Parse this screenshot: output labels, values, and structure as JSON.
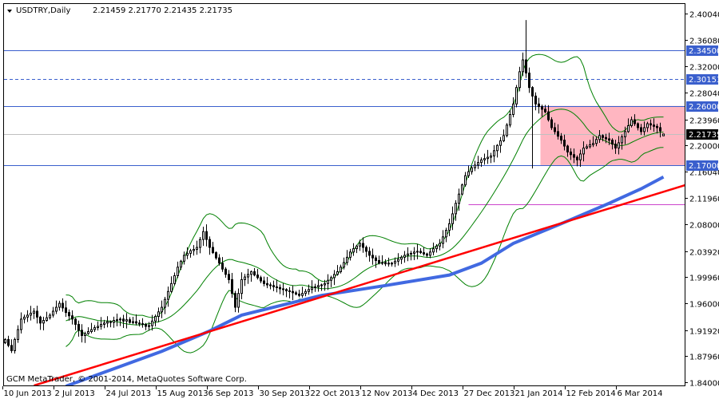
{
  "header": {
    "symbol_timeframe": "USDTRY,Daily",
    "ohlc": "2.21459 2.21770 2.21435 2.21735",
    "menu_icon": "triangle-down-icon"
  },
  "watermark": "GCM MetaTrader, © 2001-2014, MetaQuotes Software Corp.",
  "colors": {
    "bull_body": "#ffffff",
    "bear_body": "#000000",
    "bollinger": "#008000",
    "moving_average": "#4169e1",
    "trendline": "#ff0000",
    "levels": "#3a5fcd",
    "support_line": "#cc44cc",
    "range_box": "#ffb6c1",
    "bid_line": "#c0c0c0"
  },
  "chart_data": {
    "type": "candlestick",
    "symbol": "USDTRY",
    "timeframe": "Daily",
    "ylim": [
      1.84,
      2.4004
    ],
    "grid": false,
    "y_ticks": [
      "2.40040",
      "2.36080",
      "2.32000",
      "2.28040",
      "2.23960",
      "2.20000",
      "2.16040",
      "2.11960",
      "2.08000",
      "2.03920",
      "1.99960",
      "1.96000",
      "1.91920",
      "1.87960",
      "1.84000"
    ],
    "x_labels": [
      "10 Jun 2013",
      "2 Jul 2013",
      "24 Jul 2013",
      "15 Aug 2013",
      "6 Sep 2013",
      "30 Sep 2013",
      "22 Oct 2013",
      "12 Nov 2013",
      "4 Dec 2013",
      "27 Dec 2013",
      "21 Jan 2014",
      "12 Feb 2014",
      "6 Mar 2014"
    ],
    "x_label_every_bars": 16,
    "closes": [
      1.905,
      1.896,
      1.888,
      1.905,
      1.92,
      1.936,
      1.939,
      1.942,
      1.945,
      1.948,
      1.939,
      1.93,
      1.934,
      1.938,
      1.942,
      1.948,
      1.954,
      1.96,
      1.953,
      1.946,
      1.941,
      1.936,
      1.928,
      1.919,
      1.911,
      1.914,
      1.917,
      1.92,
      1.923,
      1.925,
      1.928,
      1.93,
      1.932,
      1.931,
      1.934,
      1.935,
      1.936,
      1.933,
      1.935,
      1.931,
      1.932,
      1.93,
      1.929,
      1.928,
      1.925,
      1.926,
      1.933,
      1.94,
      1.947,
      1.954,
      1.966,
      1.978,
      1.99,
      2.002,
      2.015,
      2.024,
      2.033,
      2.036,
      2.04,
      2.042,
      2.045,
      2.057,
      2.069,
      2.057,
      2.045,
      2.037,
      2.029,
      2.021,
      2.012,
      2.004,
      1.996,
      1.975,
      1.954,
      1.975,
      1.996,
      2.0,
      2.004,
      2.008,
      2.003,
      1.999,
      1.994,
      1.99,
      1.988,
      1.987,
      1.985,
      1.984,
      1.982,
      1.981,
      1.979,
      1.978,
      1.976,
      1.974,
      1.972,
      1.975,
      1.978,
      1.981,
      1.984,
      1.985,
      1.987,
      1.988,
      1.99,
      1.995,
      1.999,
      2.004,
      2.008,
      2.015,
      2.022,
      2.03,
      2.038,
      2.043,
      2.047,
      2.051,
      2.045,
      2.039,
      2.033,
      2.029,
      2.025,
      2.021,
      2.022,
      2.02,
      2.021,
      2.021,
      2.024,
      2.027,
      2.03,
      2.033,
      2.035,
      2.036,
      2.038,
      2.039,
      2.037,
      2.035,
      2.033,
      2.038,
      2.043,
      2.047,
      2.051,
      2.061,
      2.071,
      2.081,
      2.096,
      2.112,
      2.126,
      2.14,
      2.154,
      2.16,
      2.166,
      2.17,
      2.174,
      2.178,
      2.18,
      2.182,
      2.184,
      2.192,
      2.2,
      2.207,
      2.215,
      2.231,
      2.247,
      2.263,
      2.288,
      2.312,
      2.33,
      2.31,
      2.288,
      2.275,
      2.263,
      2.259,
      2.255,
      2.251,
      2.239,
      2.227,
      2.221,
      2.214,
      2.208,
      2.199,
      2.19,
      2.186,
      2.182,
      2.178,
      2.187,
      2.196,
      2.198,
      2.201,
      2.203,
      2.209,
      2.215,
      2.212,
      2.21,
      2.208,
      2.202,
      2.196,
      2.204,
      2.213,
      2.221,
      2.23,
      2.239,
      2.233,
      2.227,
      2.221,
      2.227,
      2.233,
      2.231,
      2.229,
      2.227,
      2.222,
      2.21735
    ],
    "last_bar": {
      "open": 2.21459,
      "high": 2.2177,
      "low": 2.21435,
      "close": 2.21735
    },
    "extremes": [
      {
        "bar": 163,
        "high": 2.3905
      },
      {
        "bar": 165,
        "low": 2.165
      }
    ],
    "bollinger": {
      "period": 20,
      "deviations": 2
    },
    "moving_average_points": [
      [
        19,
        1.834
      ],
      [
        49,
        1.887
      ],
      [
        64,
        1.918
      ],
      [
        74,
        1.942
      ],
      [
        99,
        1.972
      ],
      [
        119,
        1.987
      ],
      [
        139,
        2.003
      ],
      [
        149,
        2.021
      ],
      [
        159,
        2.051
      ],
      [
        174,
        2.081
      ],
      [
        189,
        2.112
      ],
      [
        199,
        2.134
      ],
      [
        206,
        2.152
      ]
    ],
    "trendline": [
      [
        9,
        1.835
      ],
      [
        213,
        2.14
      ]
    ],
    "horizontal_levels": [
      {
        "price": 2.345,
        "label": "2.34500",
        "style": "solid"
      },
      {
        "price": 2.30153,
        "label": "2.30153",
        "style": "dashed"
      },
      {
        "price": 2.26,
        "label": "2.26000",
        "style": "solid"
      },
      {
        "price": 2.17,
        "label": "2.17000",
        "style": "solid"
      }
    ],
    "bid": {
      "price": 2.21735,
      "label": "2.21735"
    },
    "support_segment": {
      "price": 2.1104,
      "from_bar": 145
    },
    "range_box": {
      "top": 2.26,
      "bottom": 2.17,
      "from_bar": 168
    }
  }
}
